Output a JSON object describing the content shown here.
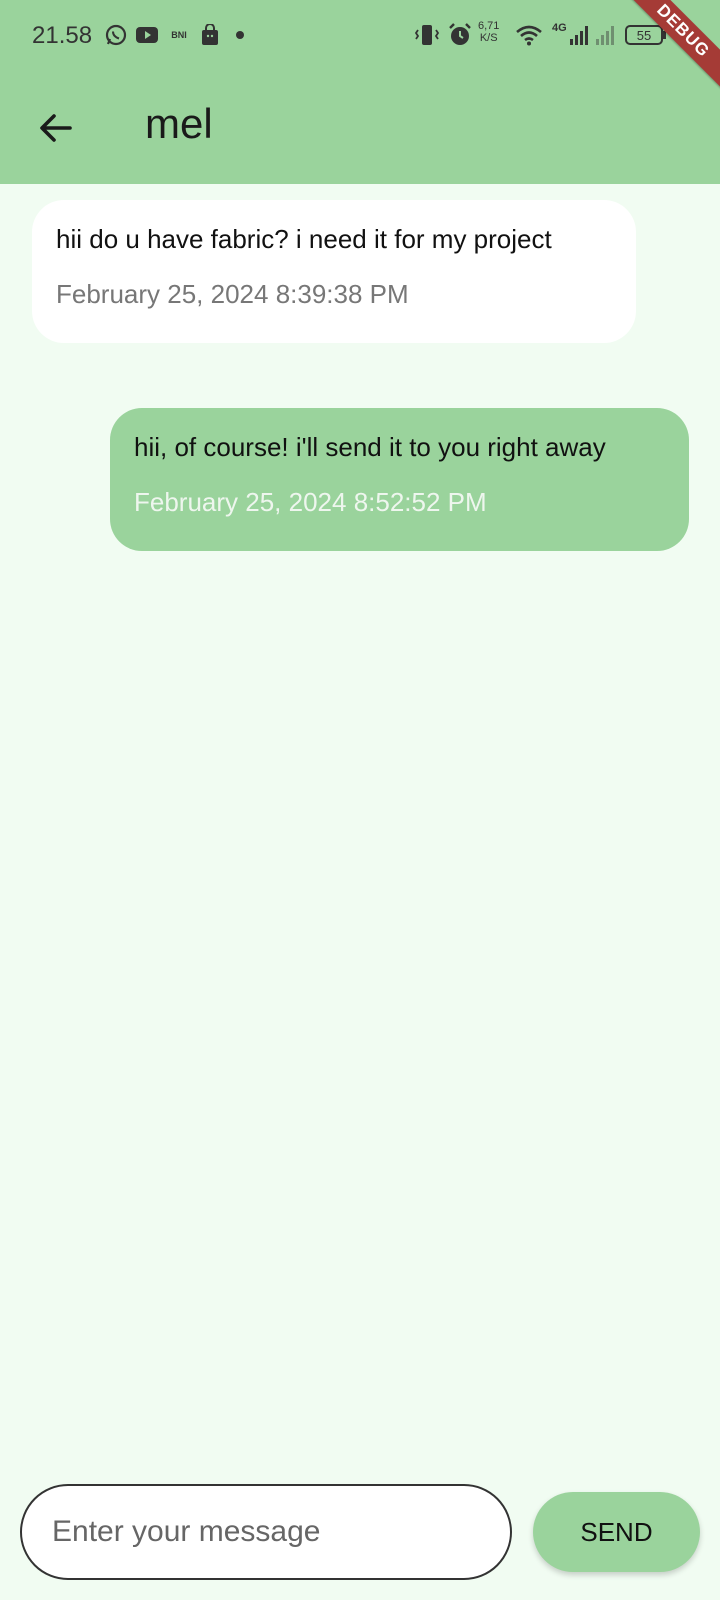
{
  "status_bar": {
    "time": "21.58",
    "bank_label": "BNI",
    "net_speed_value": "6,71",
    "net_speed_unit": "K/S",
    "network_type": "4G",
    "battery": "55"
  },
  "debug_banner": "DEBUG",
  "header": {
    "title": "mel"
  },
  "messages": [
    {
      "text": "hii do u have fabric? i need it for my project",
      "time": "February 25, 2024 8:39:38 PM",
      "direction": "incoming"
    },
    {
      "text": "hii, of course! i'll send it to you right away",
      "time": "February 25, 2024 8:52:52 PM",
      "direction": "outgoing"
    }
  ],
  "composer": {
    "value": "",
    "placeholder": "Enter your message"
  },
  "send_label": "SEND",
  "colors": {
    "app_bar": "#9ad39c",
    "background": "#f1fcf2",
    "outgoing_bubble": "#9ad39c",
    "incoming_bubble": "#ffffff",
    "debug_ribbon": "#a53b36"
  },
  "icons": {
    "back": "arrow-left-icon",
    "whatsapp": "whatsapp-icon",
    "youtube": "youtube-icon",
    "bag": "shopping-bag-icon",
    "vibrate": "vibrate-icon",
    "alarm": "alarm-icon",
    "wifi": "wifi-icon",
    "signal": "signal-icon",
    "battery": "battery-icon"
  }
}
